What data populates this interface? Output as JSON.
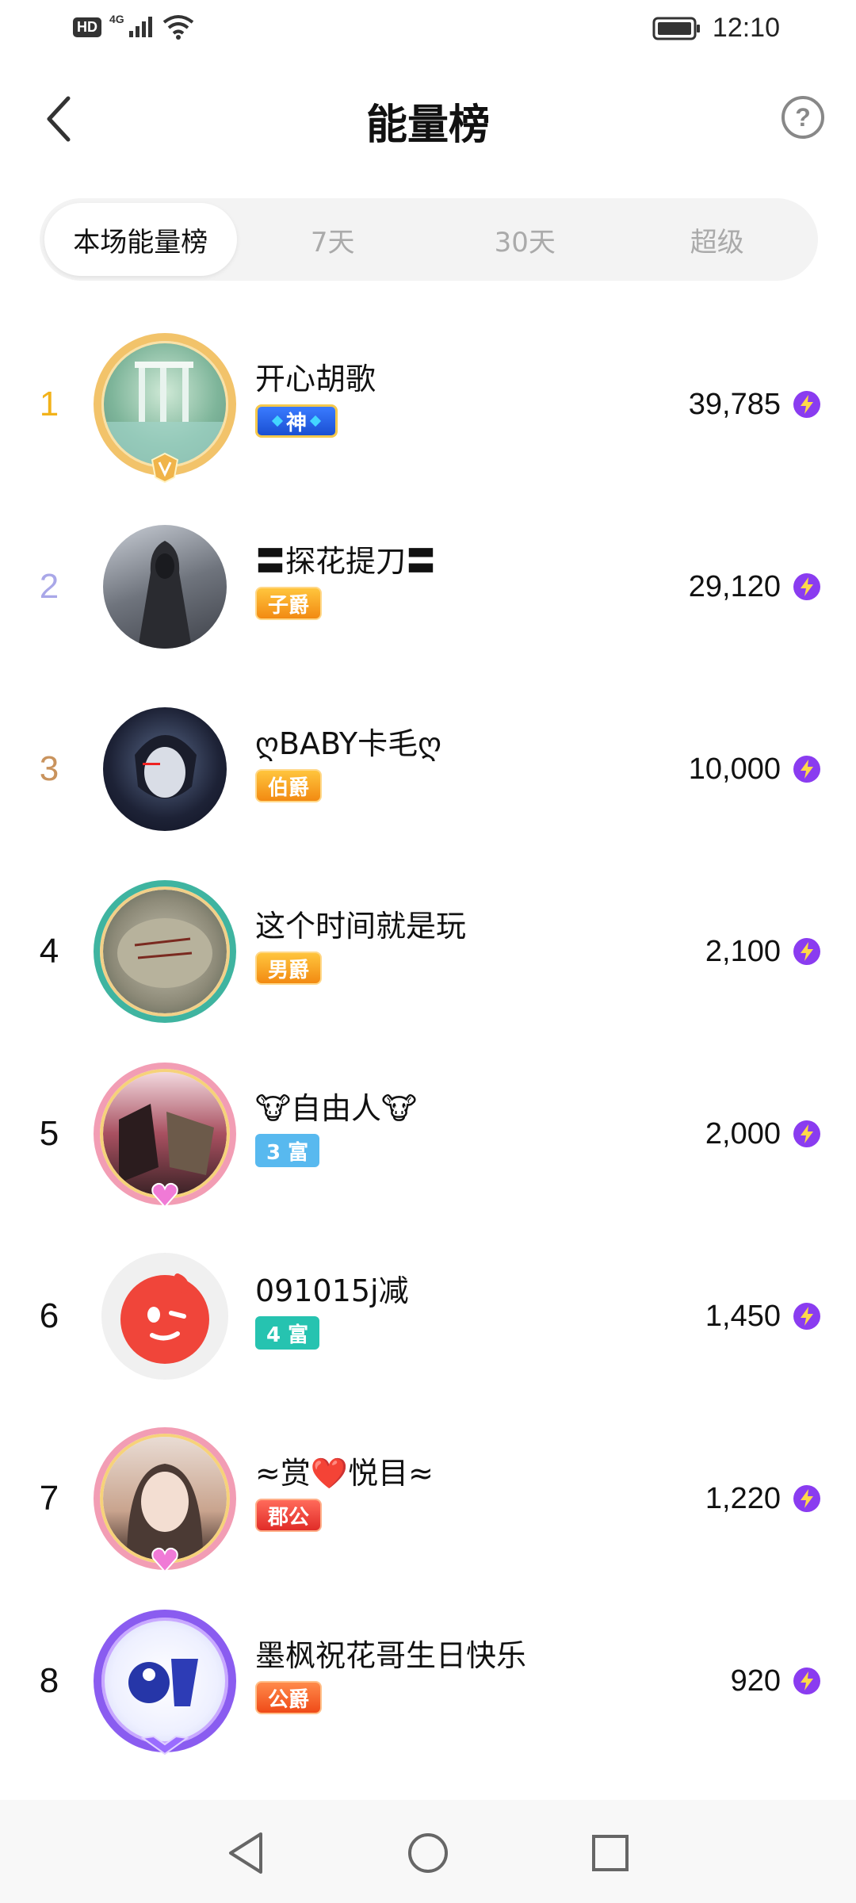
{
  "status_bar": {
    "hd": "HD",
    "network": "4G",
    "time": "12:10"
  },
  "header": {
    "title": "能量榜",
    "back_icon": "chevron-left-icon",
    "help_icon": "question-circle-icon",
    "help_glyph": "?"
  },
  "tabs": [
    {
      "label": "本场能量榜",
      "active": true
    },
    {
      "label": "7天",
      "active": false
    },
    {
      "label": "30天",
      "active": false
    },
    {
      "label": "超级",
      "active": false
    }
  ],
  "ranking": [
    {
      "rank": "1",
      "name": "开心胡歌",
      "badge": "神",
      "score": "39,785"
    },
    {
      "rank": "2",
      "name": "〓探花提刀〓",
      "badge": "子爵",
      "score": "29,120"
    },
    {
      "rank": "3",
      "name": "ღBABY卡毛ღ",
      "badge": "伯爵",
      "score": "10,000"
    },
    {
      "rank": "4",
      "name": "这个时间就是玩",
      "badge": "男爵",
      "score": "2,100"
    },
    {
      "rank": "5",
      "name": "🐮自由人🐮",
      "badge": "3 富",
      "score": "2,000"
    },
    {
      "rank": "6",
      "name": "091015j减",
      "badge": "4 富",
      "score": "1,450"
    },
    {
      "rank": "7",
      "name": "≈赏❤️悦目≈",
      "badge": "郡公",
      "score": "1,220"
    },
    {
      "rank": "8",
      "name": "墨枫祝花哥生日快乐",
      "badge": "公爵",
      "score": "920"
    }
  ],
  "colors": {
    "rank1": "#f2b21a",
    "rank2": "#a9a7e8",
    "rank3": "#c9935d",
    "energy": "#8a3cf0"
  },
  "nav": {
    "back": "triangle-back-icon",
    "home": "circle-home-icon",
    "recents": "square-recents-icon"
  }
}
